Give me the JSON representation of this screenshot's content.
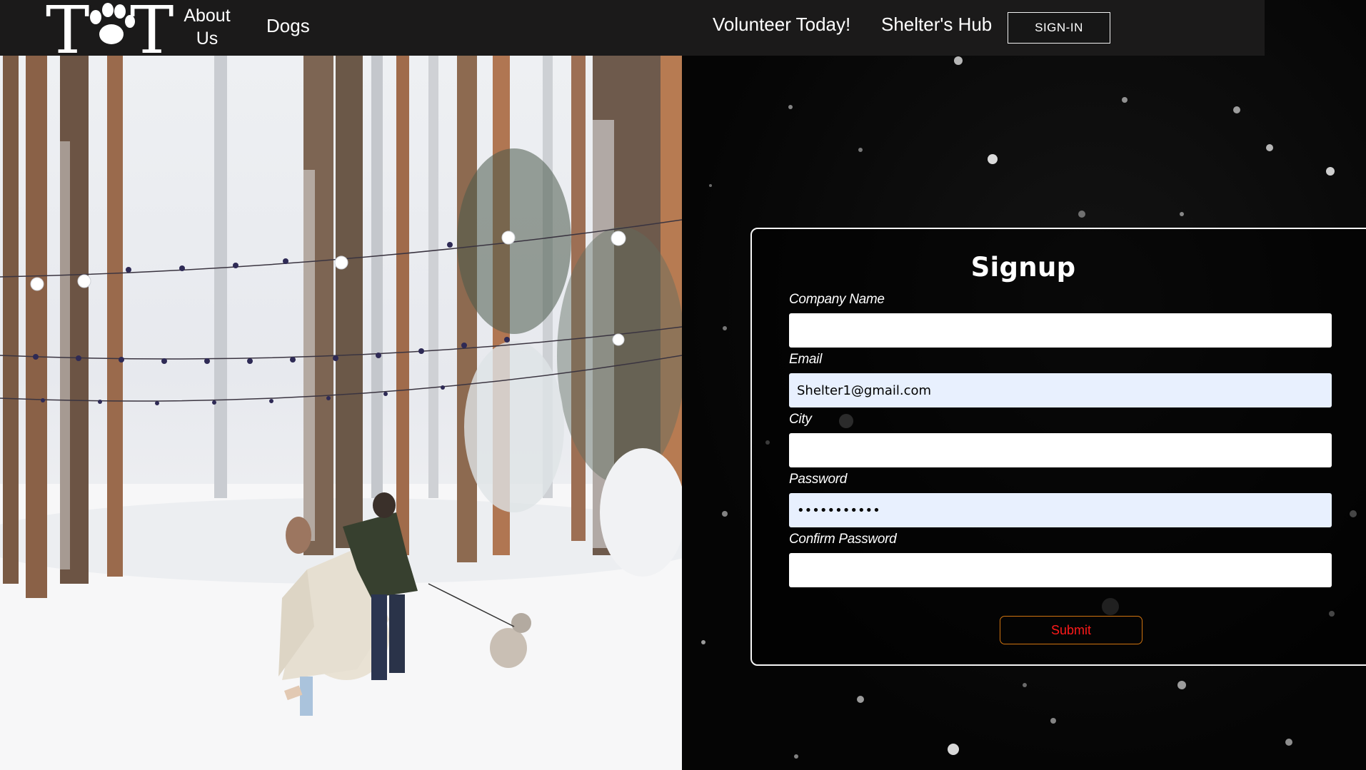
{
  "nav": {
    "logo_text": "T T",
    "about": "About Us",
    "dogs": "Dogs",
    "volunteer": "Volunteer Today!",
    "hub": "Shelter's Hub",
    "signin": "SIGN-IN"
  },
  "form": {
    "title": "Signup",
    "company_label": "Company Name",
    "company_value": "",
    "email_label": "Email",
    "email_value": "Shelter1@gmail.com",
    "city_label": "City",
    "city_value": "",
    "password_label": "Password",
    "password_value": "•••••••••••",
    "confirm_label": "Confirm Password",
    "confirm_value": "",
    "submit": "Submit"
  },
  "colors": {
    "navbar": "#1b1a1a",
    "autofill": "#e8f0fe",
    "submit_text": "#ff1a1a",
    "submit_border": "#d0740f"
  }
}
